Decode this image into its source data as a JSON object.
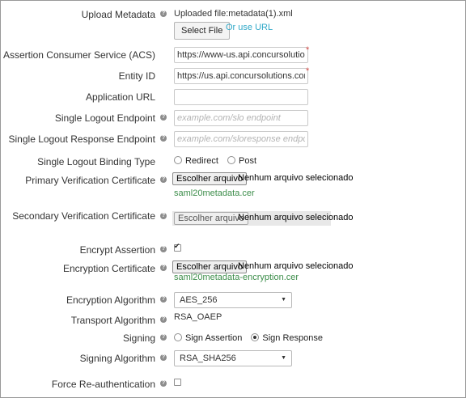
{
  "upload_metadata": {
    "label": "Upload Metadata",
    "status": "Uploaded file:metadata(1).xml",
    "select_file": "Select File",
    "or_use_url": "Or use URL"
  },
  "acs": {
    "label": "Assertion Consumer Service (ACS)",
    "value": "https://www-us.api.concursolutions.com"
  },
  "entity_id": {
    "label": "Entity ID",
    "value": "https://us.api.concursolutions.com/saml"
  },
  "application_url": {
    "label": "Application URL",
    "value": ""
  },
  "slo_endpoint": {
    "label": "Single Logout Endpoint",
    "placeholder": "example.com/slo endpoint"
  },
  "slo_response": {
    "label": "Single Logout Response Endpoint",
    "placeholder": "example.com/sloresponse endpoint"
  },
  "slo_binding": {
    "label": "Single Logout Binding Type",
    "options": [
      "Redirect",
      "Post"
    ],
    "selected": ""
  },
  "primary_cert": {
    "label": "Primary Verification Certificate",
    "button": "Escolher arquivo",
    "status": "Nenhum arquivo selecionado",
    "file": "saml20metadata.cer"
  },
  "secondary_cert": {
    "label": "Secondary Verification Certificate",
    "button": "Escolher arquivo",
    "status": "Nenhum arquivo selecionado"
  },
  "encrypt_assertion": {
    "label": "Encrypt Assertion",
    "checked": true
  },
  "encryption_cert": {
    "label": "Encryption Certificate",
    "button": "Escolher arquivo",
    "status": "Nenhum arquivo selecionado",
    "file": "saml20metadata-encryption.cer"
  },
  "encryption_algorithm": {
    "label": "Encryption Algorithm",
    "value": "AES_256"
  },
  "transport_algorithm": {
    "label": "Transport Algorithm",
    "value": "RSA_OAEP"
  },
  "signing": {
    "label": "Signing",
    "options": [
      "Sign Assertion",
      "Sign Response"
    ],
    "selected": "Sign Response"
  },
  "signing_algorithm": {
    "label": "Signing Algorithm",
    "value": "RSA_SHA256"
  },
  "force_reauth": {
    "label": "Force Re-authentication",
    "checked": false
  },
  "colors": {
    "accent_link": "#31a9c9",
    "file_link": "#3c8d4a",
    "required": "#d9534f"
  },
  "icons": {
    "help": "question-circle-icon",
    "dropdown": "caret-down-icon"
  }
}
